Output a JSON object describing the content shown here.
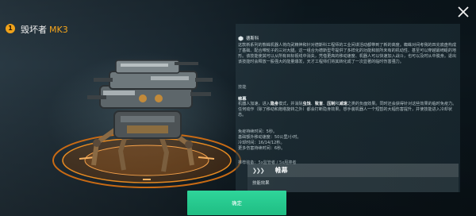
{
  "header": {
    "badge": "1",
    "robot_name": "毁坏者",
    "robot_mk": "MK3"
  },
  "colors": {
    "accent_orange": "#f5a51c",
    "confirm_green": "#1fbd83"
  },
  "info": {
    "brand": "德斯科",
    "description": "这款新系列的熊蛛机器人将向武精神和针对德斯科工程师的工业间谍活动都带到了新的高度。蜘蛛对间考我的四充底盘构成了基础、配合带轮子的三对大腿。这一组合为德斯型号提供了多样化的功能和前所未有的机动性、甚至可以穿越最崎岖的地形。该技能使其可以从所有目标视线中消失，凭借更高的移动速度、机器人可以快速加入战斗，也可以及时从中脱身。退出该技能时会释放一股强大的能量爆发，天才工程师们将其转化成了一次显著的临时伤害强力。",
    "skill_caption": "技能",
    "skill_name": "帷幕",
    "skill_desc_pre": "机器人加速，进入",
    "skill_kw1": "隐身",
    "skill_desc_mid1": "模式，并消除",
    "skill_kw2": "虫蚀",
    "skill_sep1": "、",
    "skill_kw3": "致盲",
    "skill_sep2": "、",
    "skill_kw4": "压制",
    "skill_desc_mid2": "和",
    "skill_kw5": "减速",
    "skill_desc_post": "之类的负面效果。同时还会获得针对这些效果的临时免疫力。任何动作（除了移动和炮塔旋转之外）都会打断隐身效果。想手装机器人一个短暂的大幅伤害提升，并使技能进入冷却状态。",
    "stats": [
      "免疫持续时间：5秒。",
      "基础额外移动速度：50公里/小时。",
      "冷却时间：16/14/12秒。",
      "更多伤害持续时间：6秒。"
    ],
    "recommended": "推荐装备：5x监管者 / 5x甩捧者"
  },
  "card": {
    "title": "帷幕",
    "subtitle": "技能效果"
  },
  "confirm_label": "确定"
}
